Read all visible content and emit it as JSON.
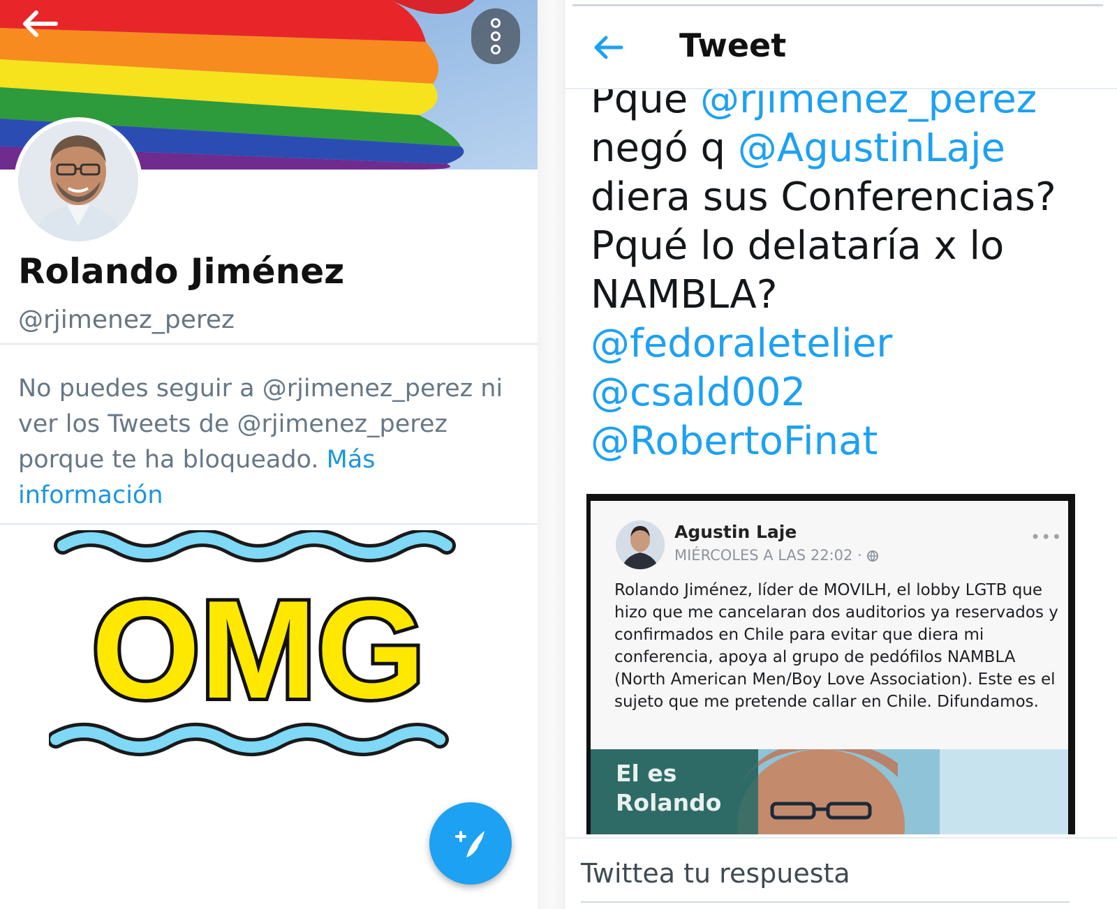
{
  "profile": {
    "name": "Rolando Jiménez",
    "handle": "@rjimenez_perez",
    "blocked_notice": "No puedes seguir a @rjimenez_perez ni ver los Tweets de @rjimenez_perez porque te ha bloqueado.",
    "more_info_link": "Más información",
    "overlay_text": "OMG"
  },
  "icons": {
    "back": "arrow-left-icon",
    "more": "more-vertical-icon",
    "compose": "compose-tweet-icon",
    "globe": "globe-icon"
  },
  "tweet": {
    "header_title": "Tweet",
    "lines": [
      {
        "pre": "Pqué ",
        "mention": "@rjimenez_perez",
        "post": ""
      },
      {
        "pre": "negó q ",
        "mention": "@AgustinLaje",
        "post": ""
      },
      {
        "pre": "diera sus Conferencias?",
        "mention": "",
        "post": ""
      },
      {
        "pre": "Pqué lo delataría x lo",
        "mention": "",
        "post": ""
      },
      {
        "pre": "NAMBLA?",
        "mention": "",
        "post": ""
      },
      {
        "pre": "",
        "mention": "@fedoraletelier",
        "post": ""
      },
      {
        "pre": "",
        "mention": "@csald002",
        "post": ""
      },
      {
        "pre": "",
        "mention": "@RobertoFinat",
        "post": ""
      }
    ],
    "embedded_post": {
      "author": "Agustin Laje",
      "meta": "MIÉRCOLES A LAS 22:02 ·",
      "dots": "•••",
      "body": "Rolando Jiménez, líder de MOVILH, el lobby LGTB que hizo que me cancelaran dos auditorios ya reservados y confirmados en Chile para evitar que diera mi conferencia, apoya al grupo de pedófilos NAMBLA (North American Men/Boy Love Association). Este es el sujeto que me pretende callar en Chile. Difundamos.",
      "photo_caption_1": "El es",
      "photo_caption_2": "Rolando"
    },
    "reply_placeholder": "Twittea tu respuesta"
  },
  "colors": {
    "twitter_blue": "#1da1f2",
    "link_blue": "#1b95e0",
    "omg_yellow": "#ffe800",
    "wave_blue": "#7fd8f5"
  }
}
